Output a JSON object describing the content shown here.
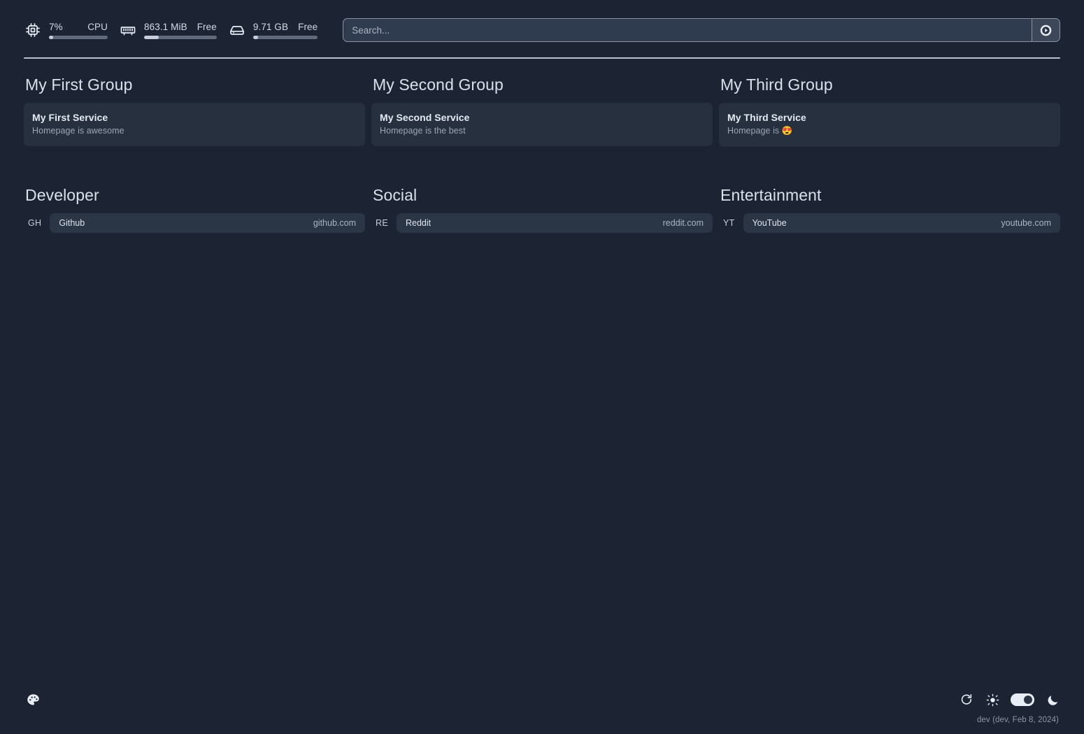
{
  "header": {
    "widgets": [
      {
        "id": "cpu",
        "icon": "cpu-chip-icon",
        "value": "7%",
        "label": "CPU",
        "percent": 7
      },
      {
        "id": "memory",
        "icon": "memory-stick-icon",
        "value": "863.1 MiB",
        "label": "Free",
        "percent": 20
      },
      {
        "id": "disk",
        "icon": "hard-drive-icon",
        "value": "9.71 GB",
        "label": "Free",
        "percent": 8
      }
    ],
    "search": {
      "placeholder": "Search...",
      "value": "",
      "button_icon": "search-provider-icon"
    }
  },
  "service_groups": [
    {
      "title": "My First Group",
      "services": [
        {
          "name": "My First Service",
          "description": "Homepage is awesome"
        }
      ]
    },
    {
      "title": "My Second Group",
      "services": [
        {
          "name": "My Second Service",
          "description": "Homepage is the best"
        }
      ]
    },
    {
      "title": "My Third Group",
      "services": [
        {
          "name": "My Third Service",
          "description": "Homepage is 😍"
        }
      ]
    }
  ],
  "bookmark_groups": [
    {
      "title": "Developer",
      "bookmarks": [
        {
          "abbr": "GH",
          "name": "Github",
          "host": "github.com"
        }
      ]
    },
    {
      "title": "Social",
      "bookmarks": [
        {
          "abbr": "RE",
          "name": "Reddit",
          "host": "reddit.com"
        }
      ]
    },
    {
      "title": "Entertainment",
      "bookmarks": [
        {
          "abbr": "YT",
          "name": "YouTube",
          "host": "youtube.com"
        }
      ]
    }
  ],
  "footer": {
    "color_picker_icon": "palette-icon",
    "refresh_icon": "refresh-icon",
    "light_icon": "sun-icon",
    "dark_icon": "moon-icon",
    "theme_toggle_state": "on",
    "version": "dev (dev, Feb 8, 2024)"
  },
  "colors": {
    "background": "#1c2434",
    "card": "#26303f",
    "bookmark_card": "#2a3546",
    "search_field": "#2f3c50",
    "divider": "#b9c2d0",
    "text_primary": "#e4eaf3",
    "text_secondary": "#9ba6b6"
  }
}
